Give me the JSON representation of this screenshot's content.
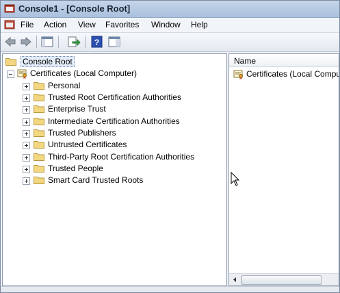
{
  "window": {
    "title": "Console1 - [Console Root]"
  },
  "menu": [
    "File",
    "Action",
    "View",
    "Favorites",
    "Window",
    "Help"
  ],
  "toolbar": {
    "buttons": [
      "back-arrow-icon",
      "forward-arrow-icon",
      "show-hide-console-tree-icon",
      "export-list-icon",
      "help-icon",
      "show-hide-action-pane-icon"
    ]
  },
  "tree": {
    "root": "Console Root",
    "store": "Certificates (Local Computer)",
    "children": [
      "Personal",
      "Trusted Root Certification Authorities",
      "Enterprise Trust",
      "Intermediate Certification Authorities",
      "Trusted Publishers",
      "Untrusted Certificates",
      "Third-Party Root Certification Authorities",
      "Trusted People",
      "Smart Card Trusted Roots"
    ]
  },
  "list": {
    "column_name": "Name",
    "items": [
      "Certificates (Local Computer)"
    ]
  },
  "colors": {
    "folder": "#f0cf6a",
    "selection": "#e3edf9"
  }
}
